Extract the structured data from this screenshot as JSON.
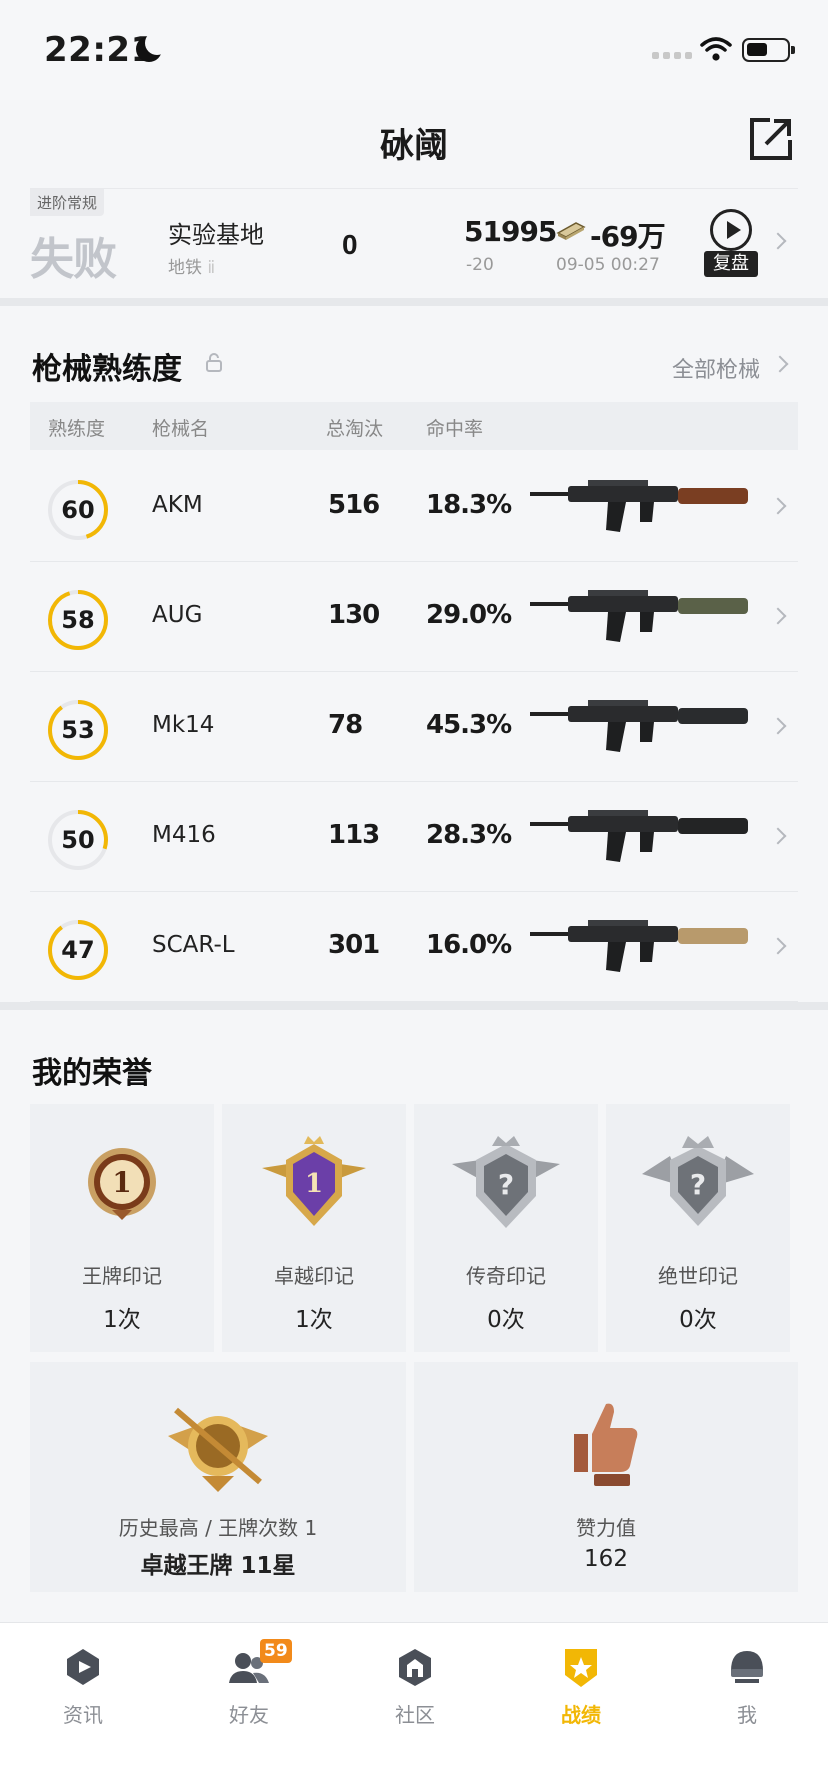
{
  "status_bar": {
    "time": "22:21"
  },
  "header": {
    "title": "砅阈"
  },
  "match": {
    "mode_tag": "进阶常规",
    "result": "失败",
    "map": "实验基地",
    "map_sub": "地铁",
    "kills": "0",
    "rating": "51995",
    "rating_change": "-20",
    "money": "-69万",
    "time": "09-05 00:27",
    "replay_label": "复盘"
  },
  "weapons": {
    "title": "枪械熟练度",
    "all_label": "全部枪械",
    "columns": [
      "熟练度",
      "枪械名",
      "总淘汰",
      "命中率"
    ],
    "rows": [
      {
        "level": "60",
        "progress": 0.45,
        "name": "AKM",
        "kills": "516",
        "accuracy": "18.3%",
        "color": "#7a3e22"
      },
      {
        "level": "58",
        "progress": 0.95,
        "name": "AUG",
        "kills": "130",
        "accuracy": "29.0%",
        "color": "#5a6148"
      },
      {
        "level": "53",
        "progress": 0.9,
        "name": "Mk14",
        "kills": "78",
        "accuracy": "45.3%",
        "color": "#2a2c2e"
      },
      {
        "level": "50",
        "progress": 0.3,
        "name": "M416",
        "kills": "113",
        "accuracy": "28.3%",
        "color": "#232425"
      },
      {
        "level": "47",
        "progress": 0.9,
        "name": "SCAR-L",
        "kills": "301",
        "accuracy": "16.0%",
        "color": "#b89a6c"
      }
    ]
  },
  "honors": {
    "title": "我的荣誉",
    "badges": [
      {
        "label": "王牌印记",
        "value": "1次",
        "icon": "ace-mark-icon"
      },
      {
        "label": "卓越印记",
        "value": "1次",
        "icon": "excellence-mark-icon"
      },
      {
        "label": "传奇印记",
        "value": "0次",
        "icon": "legend-mark-icon"
      },
      {
        "label": "绝世印记",
        "value": "0次",
        "icon": "peerless-mark-icon"
      }
    ],
    "rank": {
      "label": "历史最高 / 王牌次数 1",
      "value": "卓越王牌 11星"
    },
    "likes": {
      "label": "赞力值",
      "value": "162"
    }
  },
  "tabs": [
    {
      "label": "资讯",
      "icon": "news-icon"
    },
    {
      "label": "好友",
      "icon": "friends-icon",
      "badge": "59"
    },
    {
      "label": "社区",
      "icon": "community-icon"
    },
    {
      "label": "战绩",
      "icon": "record-icon",
      "active": true
    },
    {
      "label": "我",
      "icon": "me-icon"
    }
  ],
  "colors": {
    "accent": "#f2b705",
    "muted": "#999999",
    "ring_track": "#e6e7ea"
  }
}
